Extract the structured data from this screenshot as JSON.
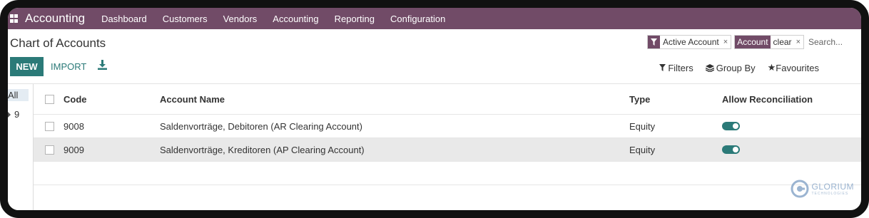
{
  "app": {
    "name": "Accounting",
    "nav": [
      "Dashboard",
      "Customers",
      "Vendors",
      "Accounting",
      "Reporting",
      "Configuration"
    ]
  },
  "page": {
    "title": "Chart of Accounts",
    "new_label": "NEW",
    "import_label": "IMPORT"
  },
  "search": {
    "facets": [
      {
        "label": "",
        "value": "Active Account"
      },
      {
        "label": "Account",
        "value": "clear"
      }
    ],
    "placeholder": "Search..."
  },
  "options": {
    "filters": "Filters",
    "group_by": "Group By",
    "favourites": "Favourites"
  },
  "sidebar": {
    "all_label": "All",
    "groups": [
      "9"
    ]
  },
  "table": {
    "columns": [
      "Code",
      "Account Name",
      "Type",
      "Allow Reconciliation"
    ],
    "rows": [
      {
        "code": "9008",
        "name": "Saldenvorträge, Debitoren (AR Clearing Account)",
        "type": "Equity",
        "reconcile": true
      },
      {
        "code": "9009",
        "name": "Saldenvorträge, Kreditoren (AP Clearing Account)",
        "type": "Equity",
        "reconcile": true
      }
    ]
  },
  "watermark": {
    "name": "GLORIUM",
    "sub": "TECHNOLOGIES"
  },
  "colors": {
    "brand": "#714b67",
    "primary": "#2b7a78"
  }
}
